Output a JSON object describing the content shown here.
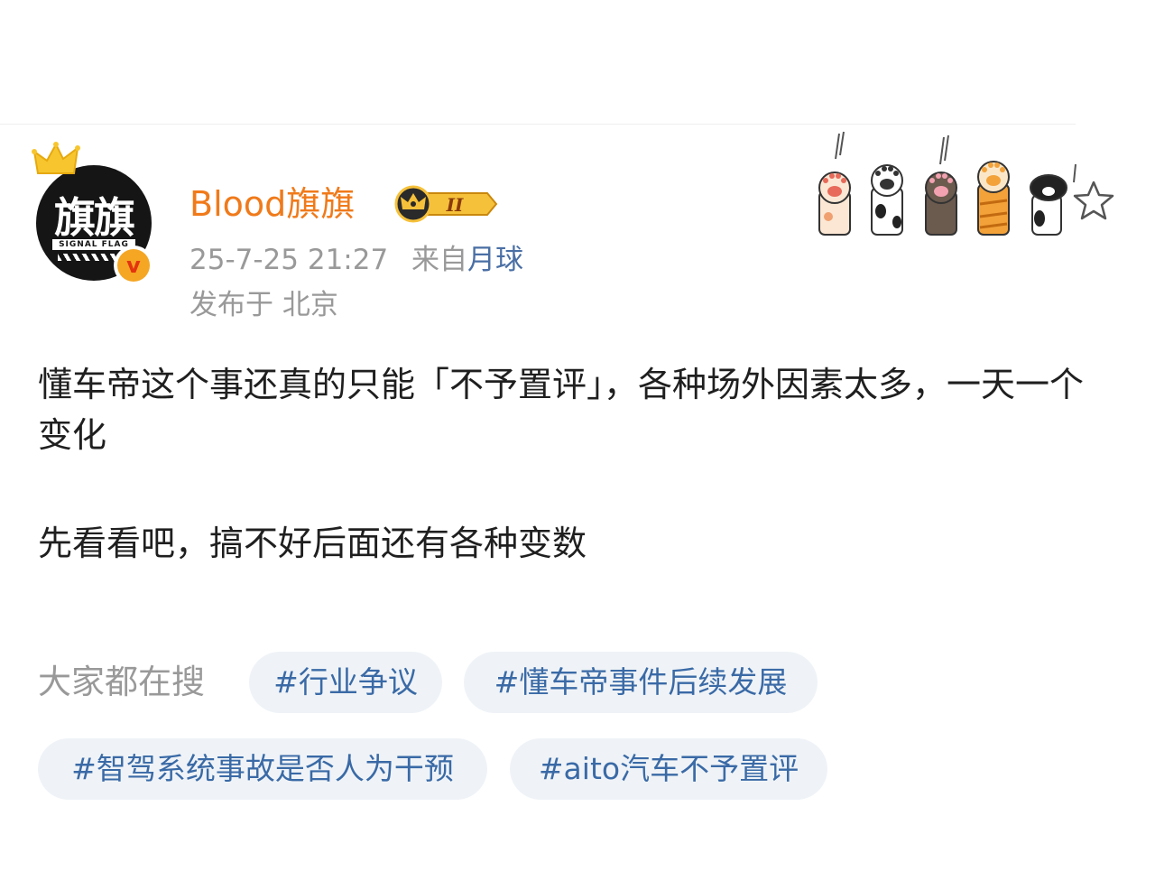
{
  "post": {
    "author": {
      "name": "Blood旗旗",
      "avatar_text": "旗旗",
      "avatar_subtext": "SIGNAL FLAG",
      "verified_mark": "v",
      "vip_level": "II"
    },
    "timestamp": "25-7-25 21:27",
    "source_prefix": "来自",
    "source_name": "月球",
    "location": "发布于 北京",
    "body_paragraphs": [
      "懂车帝这个事还真的只能「不予置评」，各种场外因素太多，一天一个变化",
      "先看看吧，搞不好后面还有各种变数"
    ]
  },
  "search_section": {
    "label": "大家都在搜",
    "tags": [
      "#行业争议",
      "#懂车帝事件后续发展",
      "#智驾系统事故是否人为干预",
      "#aito汽车不予置评"
    ]
  },
  "colors": {
    "username": "#f07a1a",
    "link": "#4a6fa5",
    "tag_text": "#3a6aa6",
    "tag_bg": "#eff3f7",
    "muted": "#999999"
  },
  "icons": {
    "crown": "crown-icon",
    "verified": "verified-v-icon",
    "vip": "vip-crown-badge-icon",
    "decoration": "cat-paws-decoration",
    "star": "star-outline-icon"
  }
}
